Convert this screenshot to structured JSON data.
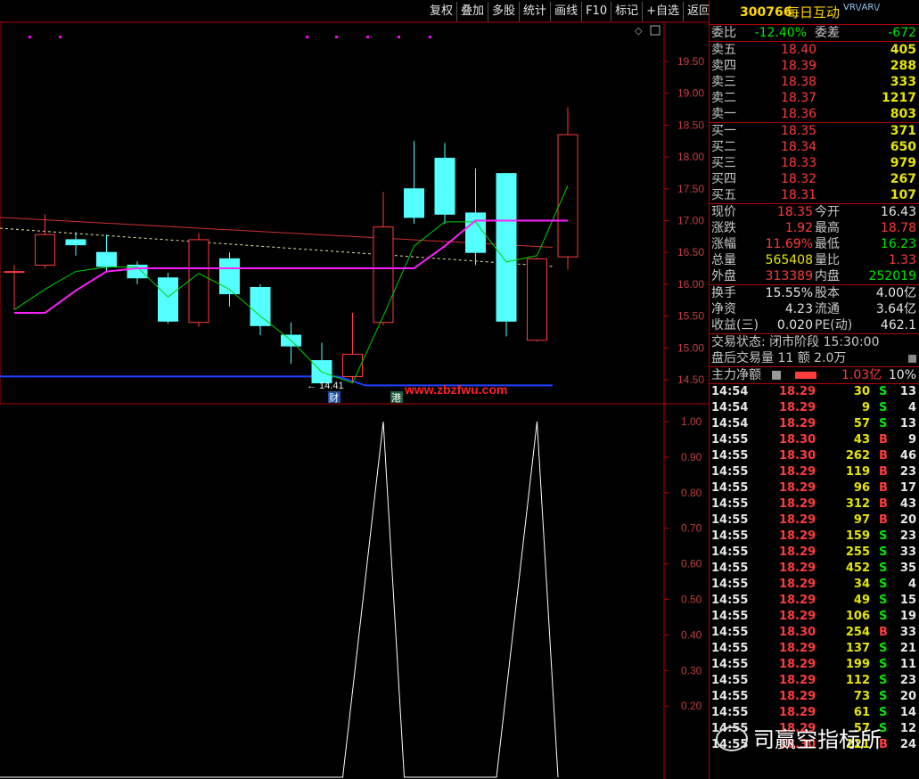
{
  "toolbar": {
    "items": [
      "复权",
      "叠加",
      "多股",
      "统计",
      "画线",
      "F10",
      "标记",
      "+自选",
      "返回"
    ]
  },
  "chart": {
    "price_axis": [
      "19.50",
      "19.00",
      "18.50",
      "18.00",
      "17.50",
      "17.00",
      "16.50",
      "16.00",
      "15.50",
      "15.00",
      "14.50"
    ],
    "ind_axis": [
      "1.00",
      "0.90",
      "0.80",
      "0.70",
      "0.60",
      "0.50",
      "0.40",
      "0.30",
      "0.20"
    ],
    "low_label": "← 14.41",
    "tag_cai": "财",
    "tag_gang": "港",
    "website": "www.zbzfwu.com",
    "candles": [
      {
        "o": 16.2,
        "c": 16.2,
        "h": 16.3,
        "l": 15.6,
        "up": true
      },
      {
        "o": 16.3,
        "c": 16.78,
        "h": 17.1,
        "l": 16.25,
        "up": true
      },
      {
        "o": 16.7,
        "c": 16.62,
        "h": 16.82,
        "l": 16.45,
        "up": false
      },
      {
        "o": 16.5,
        "c": 16.28,
        "h": 16.78,
        "l": 16.18,
        "up": false
      },
      {
        "o": 16.3,
        "c": 16.1,
        "h": 16.36,
        "l": 16.0,
        "up": false
      },
      {
        "o": 16.1,
        "c": 15.42,
        "h": 16.18,
        "l": 15.38,
        "up": false
      },
      {
        "o": 15.4,
        "c": 16.7,
        "h": 16.8,
        "l": 15.33,
        "up": true
      },
      {
        "o": 16.4,
        "c": 15.85,
        "h": 16.5,
        "l": 15.65,
        "up": false
      },
      {
        "o": 15.95,
        "c": 15.35,
        "h": 16.0,
        "l": 15.2,
        "up": false
      },
      {
        "o": 15.2,
        "c": 15.03,
        "h": 15.4,
        "l": 14.75,
        "up": false
      },
      {
        "o": 14.8,
        "c": 14.45,
        "h": 15.08,
        "l": 14.41,
        "up": false
      },
      {
        "o": 14.55,
        "c": 14.9,
        "h": 15.55,
        "l": 14.45,
        "up": true
      },
      {
        "o": 15.4,
        "c": 16.9,
        "h": 17.45,
        "l": 15.35,
        "up": true
      },
      {
        "o": 17.5,
        "c": 17.05,
        "h": 18.25,
        "l": 16.95,
        "up": false
      },
      {
        "o": 17.98,
        "c": 17.1,
        "h": 18.22,
        "l": 16.95,
        "up": false
      },
      {
        "o": 17.12,
        "c": 16.5,
        "h": 17.82,
        "l": 16.3,
        "up": false
      },
      {
        "o": 17.74,
        "c": 15.42,
        "h": 17.74,
        "l": 15.18,
        "up": false
      },
      {
        "o": 15.12,
        "c": 16.4,
        "h": 16.42,
        "l": 15.1,
        "up": true
      },
      {
        "o": 16.43,
        "c": 18.35,
        "h": 18.78,
        "l": 16.23,
        "up": true
      }
    ],
    "green_line": [
      15.6,
      15.92,
      16.2,
      16.27,
      16.27,
      15.8,
      16.17,
      15.92,
      15.5,
      15.12,
      14.62,
      14.45,
      15.5,
      16.6,
      16.98,
      16.98,
      16.35,
      16.45,
      17.55
    ],
    "magenta_line": [
      15.55,
      15.55,
      15.9,
      16.2,
      16.25,
      16.25,
      16.25,
      16.25,
      16.25,
      16.25,
      16.25,
      16.25,
      16.25,
      16.25,
      16.6,
      17.0,
      17.0,
      17.0,
      17.0
    ],
    "red_line": [
      17.05,
      16.58
    ],
    "yellow_line": [
      16.88,
      16.28
    ],
    "blue_line": [
      14.55,
      14.41
    ],
    "indicator": [
      0,
      0,
      0,
      0,
      0,
      0,
      0,
      0,
      0,
      0,
      0,
      0,
      1,
      0,
      0,
      0,
      0,
      1,
      0
    ]
  },
  "panel": {
    "code": "300766",
    "name": "每日互动",
    "tags": "VR\\/AR\\/",
    "weibi": {
      "label": "委比",
      "value": "-12.40%",
      "label2": "委差",
      "value2": "-672"
    },
    "asks": [
      {
        "label": "卖五",
        "price": "18.40",
        "vol": "405"
      },
      {
        "label": "卖四",
        "price": "18.39",
        "vol": "288"
      },
      {
        "label": "卖三",
        "price": "18.38",
        "vol": "333"
      },
      {
        "label": "卖二",
        "price": "18.37",
        "vol": "1217"
      },
      {
        "label": "卖一",
        "price": "18.36",
        "vol": "803"
      }
    ],
    "bids": [
      {
        "label": "买一",
        "price": "18.35",
        "vol": "371"
      },
      {
        "label": "买二",
        "price": "18.34",
        "vol": "650"
      },
      {
        "label": "买三",
        "price": "18.33",
        "vol": "979"
      },
      {
        "label": "买四",
        "price": "18.32",
        "vol": "267"
      },
      {
        "label": "买五",
        "price": "18.31",
        "vol": "107"
      }
    ],
    "quote": [
      {
        "l1": "现价",
        "v1": "18.35",
        "l2": "今开",
        "v2": "16.43",
        "c2": "white"
      },
      {
        "l1": "涨跌",
        "v1": "1.92",
        "l2": "最高",
        "v2": "18.78",
        "c2": "red"
      },
      {
        "l1": "涨幅",
        "v1": "11.69%",
        "l2": "最低",
        "v2": "16.23",
        "c2": "green"
      },
      {
        "l1": "总量",
        "v1": "565408",
        "l2": "量比",
        "v2": "1.33",
        "c2": "red",
        "c1": "yellow"
      },
      {
        "l1": "外盘",
        "v1": "313389",
        "l2": "内盘",
        "v2": "252019",
        "c2": "green"
      }
    ],
    "fund": [
      {
        "l1": "换手",
        "v1": "15.55%",
        "l2": "股本",
        "v2": "4.00亿"
      },
      {
        "l1": "净资",
        "v1": "4.23",
        "l2": "流通",
        "v2": "3.64亿"
      },
      {
        "l1": "收益(三)",
        "v1": "0.020",
        "l2": "PE(动)",
        "v2": "462.1"
      }
    ],
    "status": "交易状态: 闭市阶段 15:30:00",
    "after": "盘后交易量 11 额 2.0万",
    "main_label": "主力净额",
    "main_value": "1.03亿",
    "main_pct": "10%",
    "ticks": [
      [
        "14:54",
        "18.29",
        "30",
        "S",
        "13"
      ],
      [
        "14:54",
        "18.29",
        "9",
        "S",
        "4"
      ],
      [
        "14:54",
        "18.29",
        "57",
        "S",
        "13"
      ],
      [
        "14:55",
        "18.30",
        "43",
        "B",
        "9"
      ],
      [
        "14:55",
        "18.30",
        "262",
        "B",
        "46"
      ],
      [
        "14:55",
        "18.29",
        "119",
        "B",
        "23"
      ],
      [
        "14:55",
        "18.29",
        "96",
        "B",
        "17"
      ],
      [
        "14:55",
        "18.29",
        "312",
        "B",
        "43"
      ],
      [
        "14:55",
        "18.29",
        "97",
        "B",
        "20"
      ],
      [
        "14:55",
        "18.29",
        "159",
        "S",
        "23"
      ],
      [
        "14:55",
        "18.29",
        "255",
        "S",
        "33"
      ],
      [
        "14:55",
        "18.29",
        "452",
        "S",
        "35"
      ],
      [
        "14:55",
        "18.29",
        "34",
        "S",
        "4"
      ],
      [
        "14:55",
        "18.29",
        "49",
        "S",
        "15"
      ],
      [
        "14:55",
        "18.29",
        "106",
        "S",
        "19"
      ],
      [
        "14:55",
        "18.30",
        "254",
        "B",
        "33"
      ],
      [
        "14:55",
        "18.29",
        "137",
        "S",
        "21"
      ],
      [
        "14:55",
        "18.29",
        "199",
        "S",
        "11"
      ],
      [
        "14:55",
        "18.29",
        "112",
        "S",
        "23"
      ],
      [
        "14:55",
        "18.29",
        "73",
        "S",
        "20"
      ],
      [
        "14:55",
        "18.29",
        "61",
        "S",
        "14"
      ],
      [
        "14:55",
        "18.29",
        "57",
        "S",
        "12"
      ],
      [
        "14:55",
        "18.30",
        "221",
        "B",
        "24"
      ]
    ],
    "watermark": "司赢空指标所"
  }
}
